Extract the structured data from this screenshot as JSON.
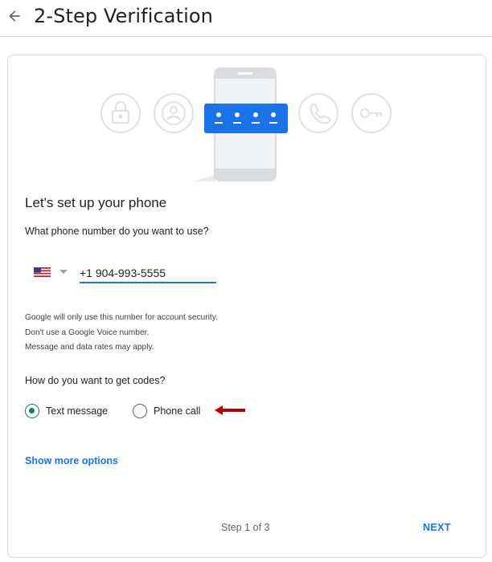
{
  "header": {
    "title": "2-Step Verification",
    "back_icon": "arrow-back-icon"
  },
  "illustration": {
    "icons": [
      "lock-icon",
      "account-icon",
      "password-dots-icon",
      "phone-icon",
      "key-icon"
    ],
    "colors": {
      "accent": "#1a73e8",
      "outline": "#e0e0e0",
      "phone_body": "#dadce0"
    }
  },
  "setup": {
    "title": "Let's set up your phone",
    "question": "What phone number do you want to use?",
    "country_flag": "us-flag-icon",
    "phone_value": "+1 904-993-5555",
    "notes": [
      "Google will only use this number for account security.",
      "Don't use a Google Voice number.",
      "Message and data rates may apply."
    ]
  },
  "codes": {
    "question": "How do you want to get codes?",
    "options": [
      {
        "label": "Text message",
        "selected": true
      },
      {
        "label": "Phone call",
        "selected": false
      }
    ],
    "annotation_color": "#b00000"
  },
  "more_options": "Show more options",
  "footer": {
    "step": "Step 1 of 3",
    "next": "NEXT"
  }
}
